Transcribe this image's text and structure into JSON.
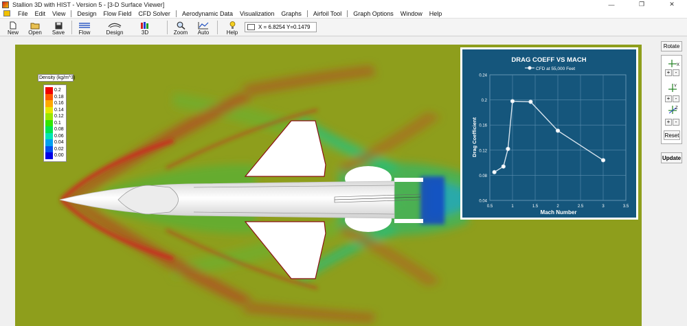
{
  "window": {
    "title": "Stallion 3D with HIST - Version 5 - [3-D Surface Viewer]",
    "controls": [
      "—",
      "❐",
      "✕"
    ]
  },
  "menu": {
    "items": [
      "File",
      "Edit",
      "View",
      "Design",
      "Flow Field",
      "CFD Solver",
      "Aerodynamic Data",
      "Visualization",
      "Graphs",
      "Airfoil Tool",
      "Graph Options",
      "Window",
      "Help"
    ]
  },
  "toolbar": {
    "new": "New",
    "open": "Open",
    "save": "Save",
    "flow": "Flow",
    "design": "Design",
    "view3d": "3D",
    "zoom": "Zoom",
    "auto": "Auto",
    "help": "Help",
    "coords": "X = 6.8254  Y=0.1479"
  },
  "legend": {
    "title": "Density (kg/m^3)",
    "entries": [
      {
        "value": "0.2",
        "color": "#f00000"
      },
      {
        "value": "0.18",
        "color": "#ff5a00"
      },
      {
        "value": "0.16",
        "color": "#ffa800"
      },
      {
        "value": "0.14",
        "color": "#e6e600"
      },
      {
        "value": "0.12",
        "color": "#9ae600"
      },
      {
        "value": "0.1",
        "color": "#32e600"
      },
      {
        "value": "0.08",
        "color": "#00e650"
      },
      {
        "value": "0.06",
        "color": "#00e6b4"
      },
      {
        "value": "0.04",
        "color": "#00a0f0"
      },
      {
        "value": "0.02",
        "color": "#0050f0"
      },
      {
        "value": "0.00",
        "color": "#0000e6"
      }
    ]
  },
  "side": {
    "rotate": "Rotate",
    "reset": "Reset",
    "update": "Update",
    "plus": "+",
    "minus": "-",
    "axis_x": "X",
    "axis_y": "Y",
    "axis_z": "Z"
  },
  "chart_data": {
    "type": "line",
    "title": "DRAG COEFF VS MACH",
    "xlabel": "Mach Number",
    "ylabel": "Drag Coefficient",
    "xlim": [
      0.5,
      3.5
    ],
    "ylim": [
      0.04,
      0.24
    ],
    "xticks": [
      0.5,
      1,
      1.5,
      2,
      2.5,
      3,
      3.5
    ],
    "xtick_labels": [
      "0.5",
      "1",
      "1.5",
      "2",
      "2.5",
      "3",
      "3.5"
    ],
    "yticks": [
      0.04,
      0.08,
      0.12,
      0.16,
      0.2,
      0.24
    ],
    "ytick_labels": [
      "0.04",
      "0.08",
      "0.12",
      "0.16",
      "0.2",
      "0.24"
    ],
    "grid": true,
    "legend_position": "top-center",
    "series": [
      {
        "name": "CFD at 55,000 Feet",
        "color": "#d8e4ee",
        "x": [
          0.6,
          0.8,
          0.9,
          1.0,
          1.4,
          2.0,
          3.0
        ],
        "y": [
          0.085,
          0.094,
          0.122,
          0.198,
          0.197,
          0.151,
          0.104
        ]
      }
    ],
    "background": "#15567c"
  }
}
